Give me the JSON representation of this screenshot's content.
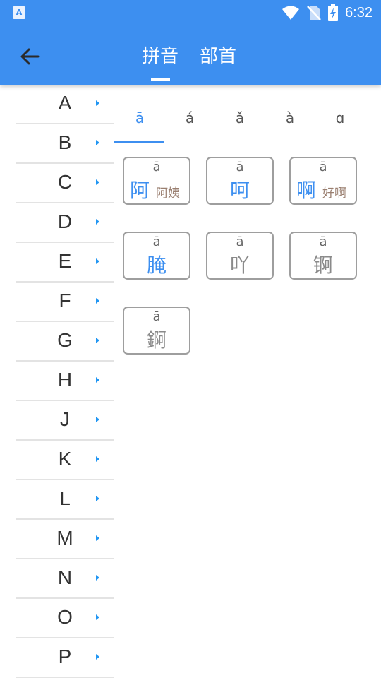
{
  "status_bar": {
    "time": "6:32",
    "app_icon": "A"
  },
  "header": {
    "tabs": [
      {
        "label": "拼音"
      },
      {
        "label": "部首"
      }
    ]
  },
  "letters": [
    "A",
    "B",
    "C",
    "D",
    "E",
    "F",
    "G",
    "H",
    "J",
    "K",
    "L",
    "M",
    "N",
    "O",
    "P"
  ],
  "tones": [
    "ā",
    "á",
    "ǎ",
    "à",
    "ɑ"
  ],
  "cards": [
    {
      "pinyin": "ā",
      "char": "阿",
      "word": "阿姨"
    },
    {
      "pinyin": "ā",
      "char": "呵",
      "word": ""
    },
    {
      "pinyin": "ā",
      "char": "啊",
      "word": "好啊"
    },
    {
      "pinyin": "ā",
      "char": "腌",
      "word": ""
    },
    {
      "pinyin": "ā",
      "char": "吖",
      "word": ""
    },
    {
      "pinyin": "ā",
      "char": "锕",
      "word": ""
    },
    {
      "pinyin": "ā",
      "char": "錒",
      "word": ""
    }
  ],
  "colors": {
    "accent": "#3d8ff0",
    "arrow": "#2196f3",
    "muted_char": "#8a8a8a",
    "word": "#9a7f70"
  }
}
